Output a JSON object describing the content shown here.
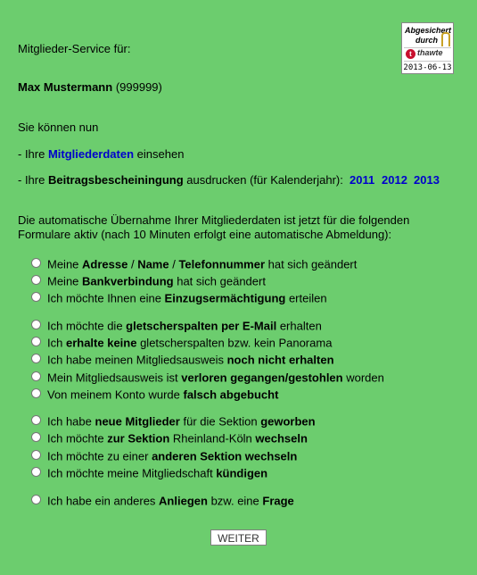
{
  "header": {
    "service_label": "Mitglieder-Service für:",
    "member_name": "Max Mustermann",
    "member_id": "(999999)"
  },
  "seal": {
    "line1": "Abgesichert",
    "line2": "durch",
    "logo_text": "thawte",
    "date": "2013-06-13"
  },
  "intro": {
    "can_now": "Sie können nun",
    "line1_prefix": "- Ihre ",
    "line1_link": "Mitgliederdaten",
    "line1_suffix": " einsehen",
    "line2_prefix": "- Ihre ",
    "line2_bold": "Beitragsbescheiningung",
    "line2_suffix": " ausdrucken (für Kalenderjahr):",
    "years": [
      "2011",
      "2012",
      "2013"
    ]
  },
  "notice": {
    "line1": "Die automatische Übernahme Ihrer Mitgliederdaten ist jetzt für die folgenden",
    "line2": "Formulare aktiv (nach 10 Minuten erfolgt eine automatische Abmeldung):"
  },
  "options": [
    [
      [
        "Meine ",
        false
      ],
      [
        "Adresse",
        true
      ],
      [
        " / ",
        false
      ],
      [
        "Name",
        true
      ],
      [
        " / ",
        false
      ],
      [
        "Telefonnummer",
        true
      ],
      [
        " hat sich geändert",
        false
      ]
    ],
    [
      [
        "Meine ",
        false
      ],
      [
        "Bankverbindung",
        true
      ],
      [
        " hat sich geändert",
        false
      ]
    ],
    [
      [
        "Ich möchte Ihnen eine ",
        false
      ],
      [
        "Einzugsermächtigung",
        true
      ],
      [
        " erteilen",
        false
      ]
    ],
    [
      [
        "Ich möchte die ",
        false
      ],
      [
        "gletscherspalten per E-Mail",
        true
      ],
      [
        " erhalten",
        false
      ]
    ],
    [
      [
        "Ich ",
        false
      ],
      [
        "erhalte keine",
        true
      ],
      [
        " gletscherspalten bzw. kein Panorama",
        false
      ]
    ],
    [
      [
        "Ich habe meinen Mitgliedsausweis ",
        false
      ],
      [
        "noch nicht erhalten",
        true
      ]
    ],
    [
      [
        "Mein Mitgliedsausweis ist ",
        false
      ],
      [
        "verloren gegangen/gestohlen",
        true
      ],
      [
        " worden",
        false
      ]
    ],
    [
      [
        "Von meinem Konto wurde ",
        false
      ],
      [
        "falsch abgebucht",
        true
      ]
    ],
    [
      [
        "Ich habe ",
        false
      ],
      [
        "neue Mitglieder",
        true
      ],
      [
        " für die Sektion ",
        false
      ],
      [
        "geworben",
        true
      ]
    ],
    [
      [
        "Ich möchte ",
        false
      ],
      [
        "zur Sektion",
        true
      ],
      [
        " Rheinland-Köln ",
        false
      ],
      [
        "wechseln",
        true
      ]
    ],
    [
      [
        "Ich möchte zu einer ",
        false
      ],
      [
        "anderen Sektion wechseln",
        true
      ]
    ],
    [
      [
        "Ich möchte meine Mitgliedschaft ",
        false
      ],
      [
        "kündigen",
        true
      ]
    ],
    [
      [
        "Ich habe ein anderes ",
        false
      ],
      [
        "Anliegen",
        true
      ],
      [
        " bzw. eine ",
        false
      ],
      [
        "Frage",
        true
      ]
    ]
  ],
  "submit_label": "WEITER",
  "colors": {
    "background": "#6ccd6e",
    "link": "#0000cc"
  }
}
